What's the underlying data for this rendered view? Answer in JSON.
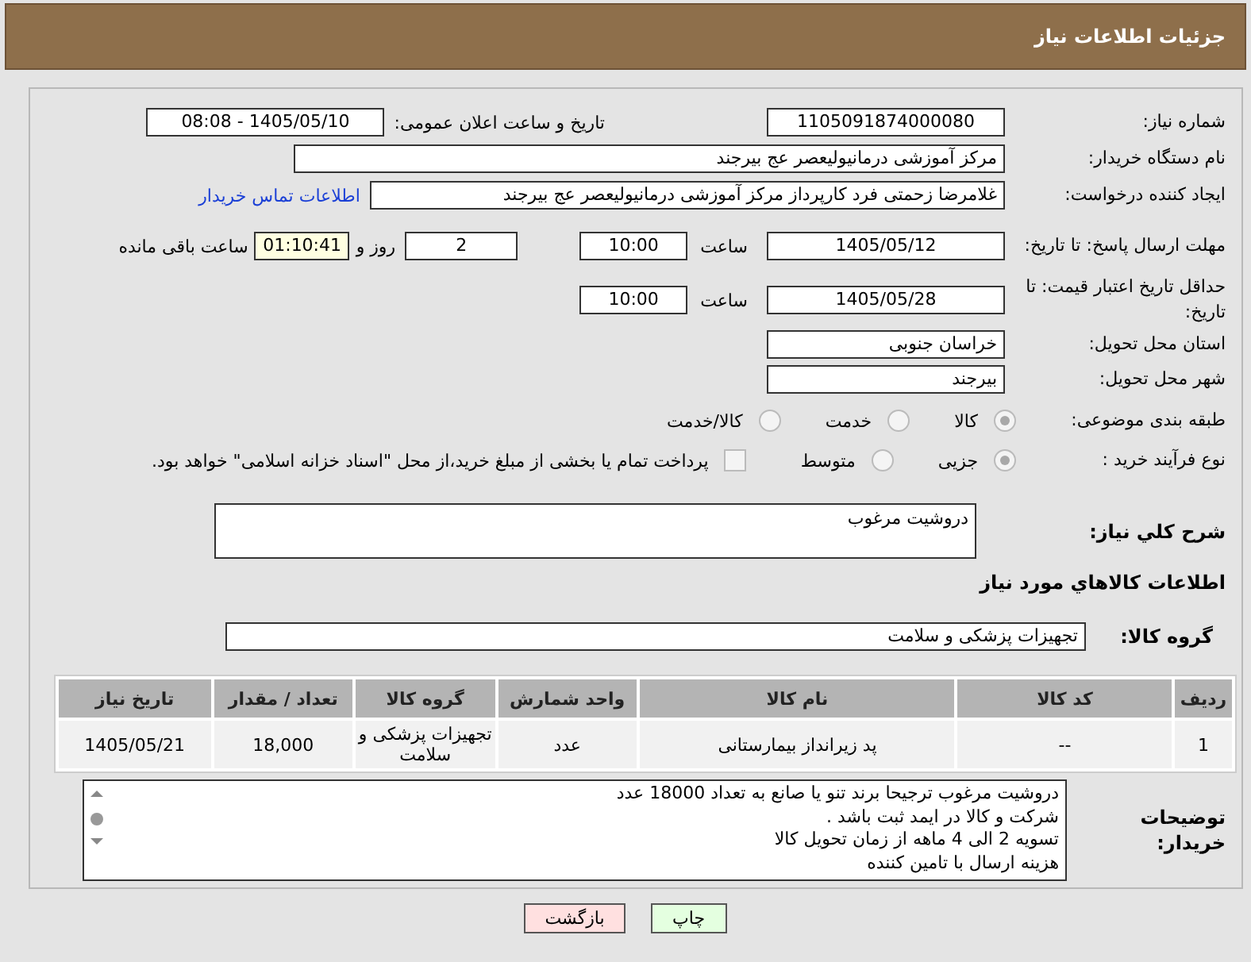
{
  "header": {
    "title": "جزئیات اطلاعات نیاز"
  },
  "need_number": {
    "label": "شماره نیاز:",
    "value": "1105091874000080"
  },
  "announce_date": {
    "label": "تاریخ و ساعت اعلان عمومی:",
    "value": "1405/05/10 - 08:08"
  },
  "buyer_org": {
    "label": "نام دستگاه خریدار:",
    "value": "مرکز آموزشی درمانیولیعصر  عج  بیرجند"
  },
  "requester": {
    "label": "ایجاد کننده درخواست:",
    "value": "غلامرضا زحمتی فرد کارپرداز مرکز آموزشی درمانیولیعصر  عج  بیرجند",
    "link": "اطلاعات تماس خریدار"
  },
  "reply_deadline": {
    "label": "مهلت ارسال پاسخ: تا تاریخ:",
    "date": "1405/05/12",
    "time_label": "ساعت",
    "time": "10:00",
    "days": "2",
    "days_label": "روز و",
    "remaining": "01:10:41",
    "remaining_label": "ساعت باقی مانده"
  },
  "price_validity": {
    "label": "حداقل تاریخ اعتبار قیمت: تا تاریخ:",
    "date": "1405/05/28",
    "time_label": "ساعت",
    "time": "10:00"
  },
  "province": {
    "label": "استان محل تحویل:",
    "value": "خراسان جنوبی"
  },
  "city": {
    "label": "شهر محل تحویل:",
    "value": "بیرجند"
  },
  "category": {
    "label": "طبقه بندی موضوعی:",
    "options": [
      {
        "label": "کالا",
        "selected": true
      },
      {
        "label": "خدمت",
        "selected": false
      },
      {
        "label": "کالا/خدمت",
        "selected": false
      }
    ]
  },
  "process": {
    "label": "نوع فرآیند خرید :",
    "options": [
      {
        "label": "جزیی",
        "selected": true
      },
      {
        "label": "متوسط",
        "selected": false
      }
    ],
    "checkbox": {
      "label": "پرداخت تمام یا بخشی از مبلغ خرید،از محل \"اسناد خزانه اسلامی\" خواهد بود.",
      "checked": false
    }
  },
  "description": {
    "label": "شرح کلي نياز:",
    "value": "دروشیت مرغوب"
  },
  "goods_title": "اطلاعات کالاهاي مورد نياز",
  "goods_group": {
    "label": "گروه کالا:",
    "value": "تجهیزات پزشکی و سلامت"
  },
  "table": {
    "columns": [
      "ردیف",
      "کد کالا",
      "نام کالا",
      "واحد شمارش",
      "گروه کالا",
      "تعداد / مقدار",
      "تاریخ نیاز"
    ],
    "rows": [
      [
        "1",
        "--",
        "پد زیرانداز بیمارستانی",
        "عدد",
        "تجهیزات پزشکی و سلامت",
        "18,000",
        "1405/05/21"
      ]
    ]
  },
  "buyer_notes": {
    "label": "توضیحات خریدار:",
    "lines": [
      "دروشیت مرغوب ترجیحا برند تنو یا صانع به تعداد 18000 عدد",
      "شرکت و کالا در ایمد ثبت باشد .",
      "تسویه 2 الی 4 ماهه از زمان تحویل کالا",
      "هزینه ارسال با تامین کننده"
    ]
  },
  "buttons": [
    {
      "label": "چاپ",
      "kind": "print"
    },
    {
      "label": "بازگشت",
      "kind": "back"
    }
  ]
}
